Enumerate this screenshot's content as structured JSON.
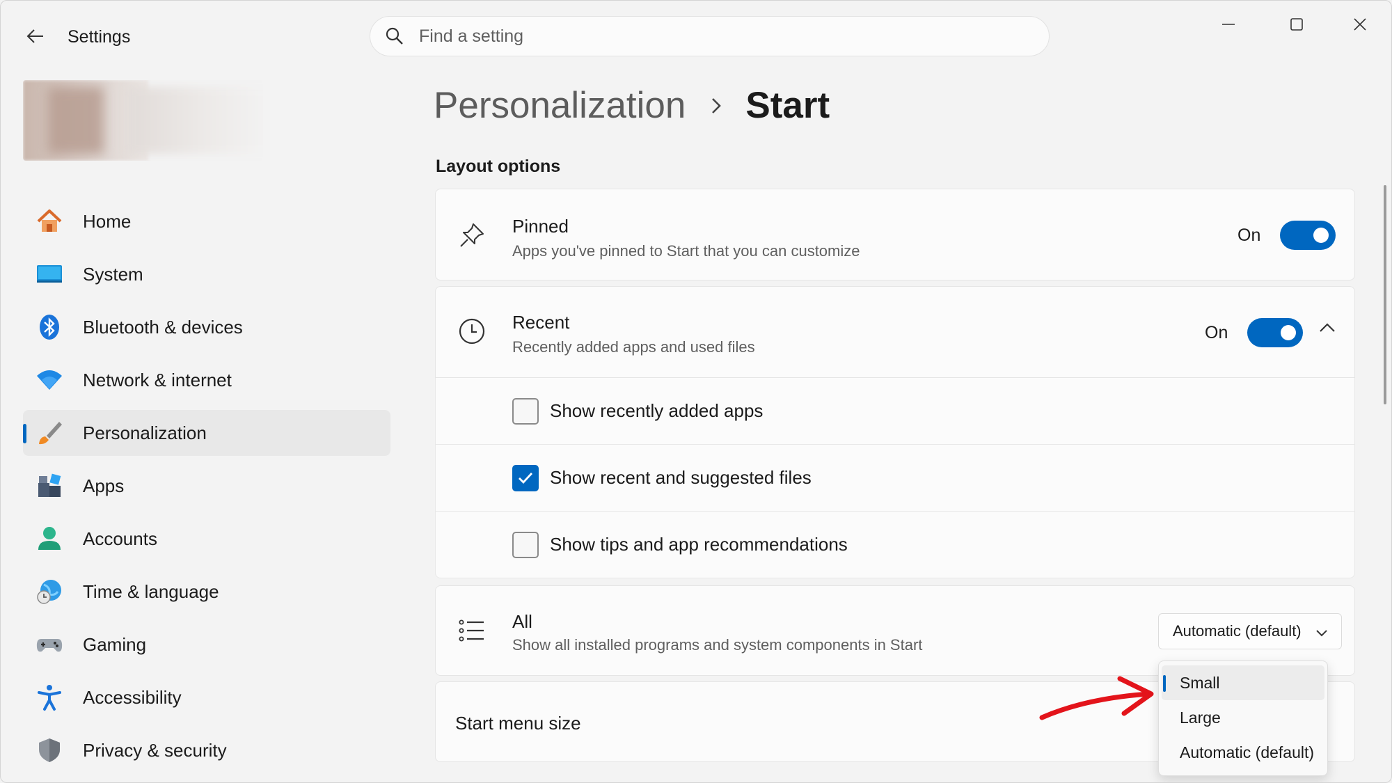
{
  "window": {
    "title": "Settings",
    "search_placeholder": "Find a setting"
  },
  "sidebar": {
    "items": [
      {
        "label": "Home",
        "icon": "home-icon"
      },
      {
        "label": "System",
        "icon": "system-icon"
      },
      {
        "label": "Bluetooth & devices",
        "icon": "bluetooth-icon"
      },
      {
        "label": "Network & internet",
        "icon": "wifi-icon"
      },
      {
        "label": "Personalization",
        "icon": "brush-icon",
        "active": true
      },
      {
        "label": "Apps",
        "icon": "apps-icon"
      },
      {
        "label": "Accounts",
        "icon": "accounts-icon"
      },
      {
        "label": "Time & language",
        "icon": "globe-clock-icon"
      },
      {
        "label": "Gaming",
        "icon": "gamepad-icon"
      },
      {
        "label": "Accessibility",
        "icon": "accessibility-icon"
      },
      {
        "label": "Privacy & security",
        "icon": "shield-icon"
      }
    ]
  },
  "breadcrumb": {
    "parent": "Personalization",
    "current": "Start"
  },
  "layout_options": {
    "heading": "Layout options",
    "pinned": {
      "title": "Pinned",
      "description": "Apps you've pinned to Start that you can customize",
      "state": "On"
    },
    "recent": {
      "title": "Recent",
      "description": "Recently added apps and used files",
      "state": "On",
      "options": [
        {
          "label": "Show recently added apps",
          "checked": false
        },
        {
          "label": "Show recent and suggested files",
          "checked": true
        },
        {
          "label": "Show tips and app recommendations",
          "checked": false
        }
      ]
    },
    "all": {
      "title": "All",
      "description": "Show all installed programs and system components in Start",
      "selected": "Automatic (default)"
    },
    "start_menu_size": {
      "title": "Start menu size",
      "dropdown_options": [
        "Small",
        "Large",
        "Automatic (default)"
      ],
      "highlighted": "Small"
    }
  },
  "colors": {
    "accent": "#0067c0",
    "annotation_arrow": "#e3141b"
  }
}
